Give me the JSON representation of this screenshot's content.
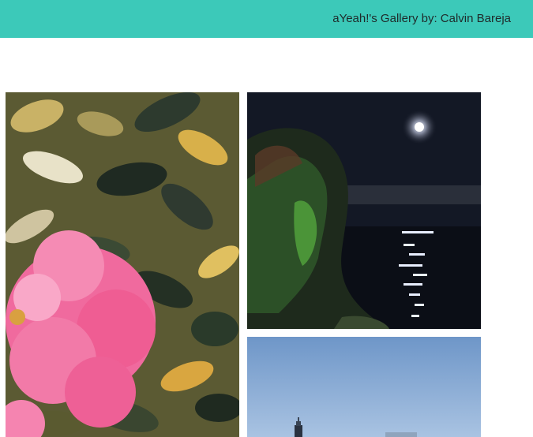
{
  "header": {
    "title": "aYeah!'s Gallery by: Calvin Bareja",
    "background_color": "#3cc9b9"
  },
  "gallery": {
    "photos": [
      {
        "subject": "pink rose among dark green and yellow leaves"
      },
      {
        "subject": "person with green-tinted hair viewing full moon over dark water"
      },
      {
        "subject": "blue sky with distant tower"
      }
    ]
  }
}
